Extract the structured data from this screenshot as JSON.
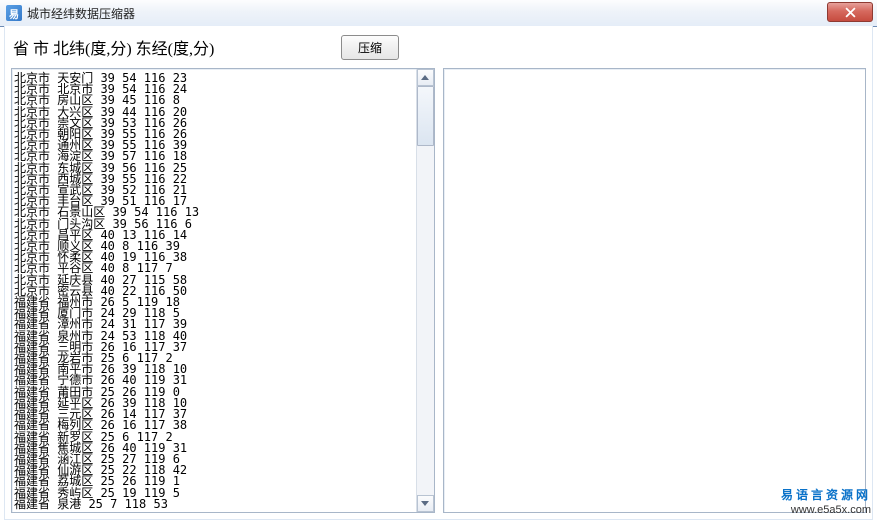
{
  "window": {
    "title": "城市经纬数据压缩器",
    "icon_glyph": "易"
  },
  "heading": "省 市 北纬(度,分) 东经(度,分)",
  "buttons": {
    "compress": "压缩"
  },
  "right_pane": "",
  "footer": {
    "site_name": "易语言资源网",
    "url": "www.e5a5x.com"
  },
  "rows": [
    {
      "prov": "北京市",
      "city": "天安门",
      "lat_d": 39,
      "lat_m": 54,
      "lon_d": 116,
      "lon_m": 23
    },
    {
      "prov": "北京市",
      "city": "北京市",
      "lat_d": 39,
      "lat_m": 54,
      "lon_d": 116,
      "lon_m": 24
    },
    {
      "prov": "北京市",
      "city": "房山区",
      "lat_d": 39,
      "lat_m": 45,
      "lon_d": 116,
      "lon_m": 8
    },
    {
      "prov": "北京市",
      "city": "大兴区",
      "lat_d": 39,
      "lat_m": 44,
      "lon_d": 116,
      "lon_m": 20
    },
    {
      "prov": "北京市",
      "city": "崇文区",
      "lat_d": 39,
      "lat_m": 53,
      "lon_d": 116,
      "lon_m": 26
    },
    {
      "prov": "北京市",
      "city": "朝阳区",
      "lat_d": 39,
      "lat_m": 55,
      "lon_d": 116,
      "lon_m": 26
    },
    {
      "prov": "北京市",
      "city": "通州区",
      "lat_d": 39,
      "lat_m": 55,
      "lon_d": 116,
      "lon_m": 39
    },
    {
      "prov": "北京市",
      "city": "海淀区",
      "lat_d": 39,
      "lat_m": 57,
      "lon_d": 116,
      "lon_m": 18
    },
    {
      "prov": "北京市",
      "city": "东城区",
      "lat_d": 39,
      "lat_m": 56,
      "lon_d": 116,
      "lon_m": 25
    },
    {
      "prov": "北京市",
      "city": "西城区",
      "lat_d": 39,
      "lat_m": 55,
      "lon_d": 116,
      "lon_m": 22
    },
    {
      "prov": "北京市",
      "city": "宣武区",
      "lat_d": 39,
      "lat_m": 52,
      "lon_d": 116,
      "lon_m": 21
    },
    {
      "prov": "北京市",
      "city": "丰台区",
      "lat_d": 39,
      "lat_m": 51,
      "lon_d": 116,
      "lon_m": 17
    },
    {
      "prov": "北京市",
      "city": "石景山区",
      "lat_d": 39,
      "lat_m": 54,
      "lon_d": 116,
      "lon_m": 13
    },
    {
      "prov": "北京市",
      "city": "门头沟区",
      "lat_d": 39,
      "lat_m": 56,
      "lon_d": 116,
      "lon_m": 6
    },
    {
      "prov": "北京市",
      "city": "昌平区",
      "lat_d": 40,
      "lat_m": 13,
      "lon_d": 116,
      "lon_m": 14
    },
    {
      "prov": "北京市",
      "city": "顺义区",
      "lat_d": 40,
      "lat_m": 8,
      "lon_d": 116,
      "lon_m": 39
    },
    {
      "prov": "北京市",
      "city": "怀柔区",
      "lat_d": 40,
      "lat_m": 19,
      "lon_d": 116,
      "lon_m": 38
    },
    {
      "prov": "北京市",
      "city": "平谷区",
      "lat_d": 40,
      "lat_m": 8,
      "lon_d": 117,
      "lon_m": 7
    },
    {
      "prov": "北京市",
      "city": "延庆县",
      "lat_d": 40,
      "lat_m": 27,
      "lon_d": 115,
      "lon_m": 58
    },
    {
      "prov": "北京市",
      "city": "密云县",
      "lat_d": 40,
      "lat_m": 22,
      "lon_d": 116,
      "lon_m": 50
    },
    {
      "prov": "福建省",
      "city": "福州市",
      "lat_d": 26,
      "lat_m": 5,
      "lon_d": 119,
      "lon_m": 18
    },
    {
      "prov": "福建省",
      "city": "厦门市",
      "lat_d": 24,
      "lat_m": 29,
      "lon_d": 118,
      "lon_m": 5
    },
    {
      "prov": "福建省",
      "city": "漳州市",
      "lat_d": 24,
      "lat_m": 31,
      "lon_d": 117,
      "lon_m": 39
    },
    {
      "prov": "福建省",
      "city": "泉州市",
      "lat_d": 24,
      "lat_m": 53,
      "lon_d": 118,
      "lon_m": 40
    },
    {
      "prov": "福建省",
      "city": "三明市",
      "lat_d": 26,
      "lat_m": 16,
      "lon_d": 117,
      "lon_m": 37
    },
    {
      "prov": "福建省",
      "city": "龙岩市",
      "lat_d": 25,
      "lat_m": 6,
      "lon_d": 117,
      "lon_m": 2
    },
    {
      "prov": "福建省",
      "city": "南平市",
      "lat_d": 26,
      "lat_m": 39,
      "lon_d": 118,
      "lon_m": 10
    },
    {
      "prov": "福建省",
      "city": "宁德市",
      "lat_d": 26,
      "lat_m": 40,
      "lon_d": 119,
      "lon_m": 31
    },
    {
      "prov": "福建省",
      "city": "莆田市",
      "lat_d": 25,
      "lat_m": 26,
      "lon_d": 119,
      "lon_m": 0
    },
    {
      "prov": "福建省",
      "city": "延平区",
      "lat_d": 26,
      "lat_m": 39,
      "lon_d": 118,
      "lon_m": 10
    },
    {
      "prov": "福建省",
      "city": "三元区",
      "lat_d": 26,
      "lat_m": 14,
      "lon_d": 117,
      "lon_m": 37
    },
    {
      "prov": "福建省",
      "city": "梅列区",
      "lat_d": 26,
      "lat_m": 16,
      "lon_d": 117,
      "lon_m": 38
    },
    {
      "prov": "福建省",
      "city": "新罗区",
      "lat_d": 25,
      "lat_m": 6,
      "lon_d": 117,
      "lon_m": 2
    },
    {
      "prov": "福建省",
      "city": "蕉城区",
      "lat_d": 26,
      "lat_m": 40,
      "lon_d": 119,
      "lon_m": 31
    },
    {
      "prov": "福建省",
      "city": "涵江区",
      "lat_d": 25,
      "lat_m": 27,
      "lon_d": 119,
      "lon_m": 6
    },
    {
      "prov": "福建省",
      "city": "仙游区",
      "lat_d": 25,
      "lat_m": 22,
      "lon_d": 118,
      "lon_m": 42
    },
    {
      "prov": "福建省",
      "city": "荔城区",
      "lat_d": 25,
      "lat_m": 26,
      "lon_d": 119,
      "lon_m": 1
    },
    {
      "prov": "福建省",
      "city": "秀屿区",
      "lat_d": 25,
      "lat_m": 19,
      "lon_d": 119,
      "lon_m": 5
    },
    {
      "prov": "福建省",
      "city": "泉港",
      "lat_d": 25,
      "lat_m": 7,
      "lon_d": 118,
      "lon_m": 53
    }
  ]
}
